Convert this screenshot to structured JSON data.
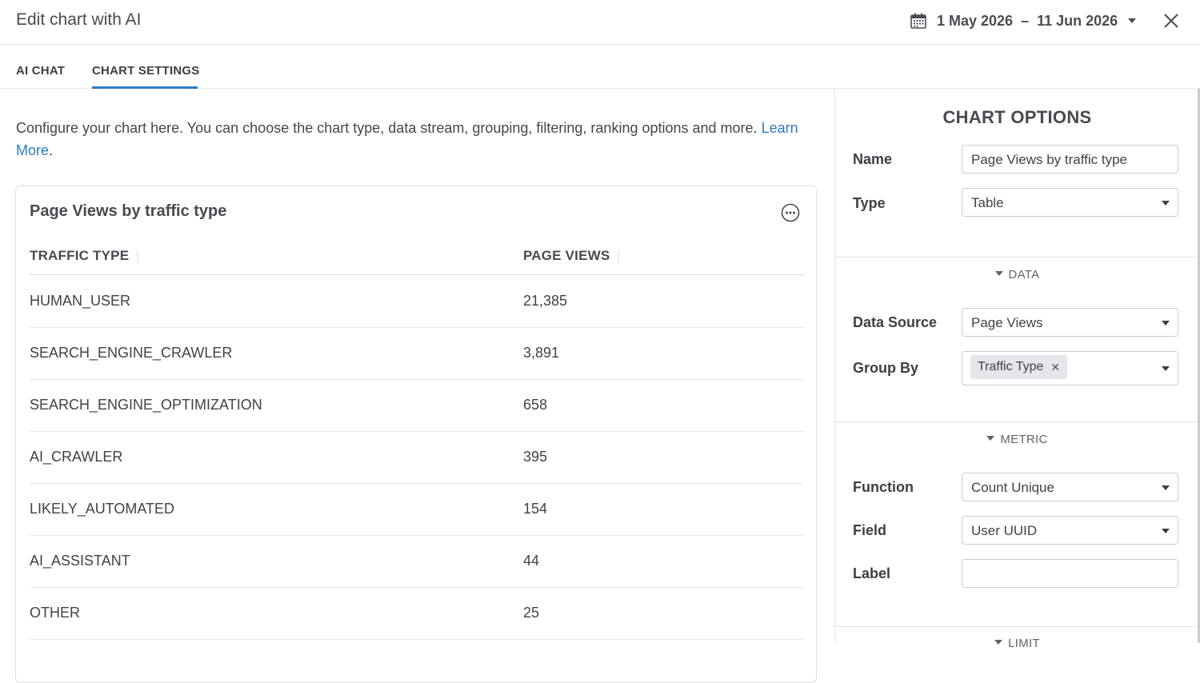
{
  "header": {
    "title": "Edit chart with AI",
    "date_range": "1 May 2026  –  11 Jun 2026",
    "icons": [
      "calendar-icon",
      "chevron-down-icon",
      "close-icon"
    ]
  },
  "tabs": [
    {
      "label": "AI CHAT",
      "active": false
    },
    {
      "label": "CHART SETTINGS",
      "active": true
    }
  ],
  "intro": {
    "text": "Configure your chart here. You can choose the chart type, data stream, grouping, filtering, ranking options and more. ",
    "link": "Learn More",
    "suffix": "."
  },
  "chart": {
    "title": "Page Views by traffic type",
    "more_icon": "more-icon",
    "columns": [
      "TRAFFIC TYPE",
      "PAGE VIEWS"
    ]
  },
  "chart_data": {
    "type": "table",
    "title": "Page Views by traffic type",
    "columns": [
      "TRAFFIC TYPE",
      "PAGE VIEWS"
    ],
    "rows": [
      [
        "HUMAN_USER",
        "21,385"
      ],
      [
        "SEARCH_ENGINE_CRAWLER",
        "3,891"
      ],
      [
        "SEARCH_ENGINE_OPTIMIZATION",
        "658"
      ],
      [
        "AI_CRAWLER",
        "395"
      ],
      [
        "LIKELY_AUTOMATED",
        "154"
      ],
      [
        "AI_ASSISTANT",
        "44"
      ],
      [
        "OTHER",
        "25"
      ]
    ]
  },
  "options": {
    "title": "CHART OPTIONS",
    "name_label": "Name",
    "name_value": "Page Views by traffic type",
    "type_label": "Type",
    "type_value": "Table",
    "data_section": "DATA",
    "data_source_label": "Data Source",
    "data_source_value": "Page Views",
    "group_by_label": "Group By",
    "group_by_chip": "Traffic Type",
    "metric_section": "METRIC",
    "function_label": "Function",
    "function_value": "Count Unique",
    "field_label": "Field",
    "field_value": "User UUID",
    "label_label": "Label",
    "label_value": "",
    "limit_section": "LIMIT"
  },
  "colors": {
    "accent": "#2f7cc8",
    "link": "#2b79c8",
    "text": "#3c3f44",
    "border": "#dfe1e4"
  }
}
